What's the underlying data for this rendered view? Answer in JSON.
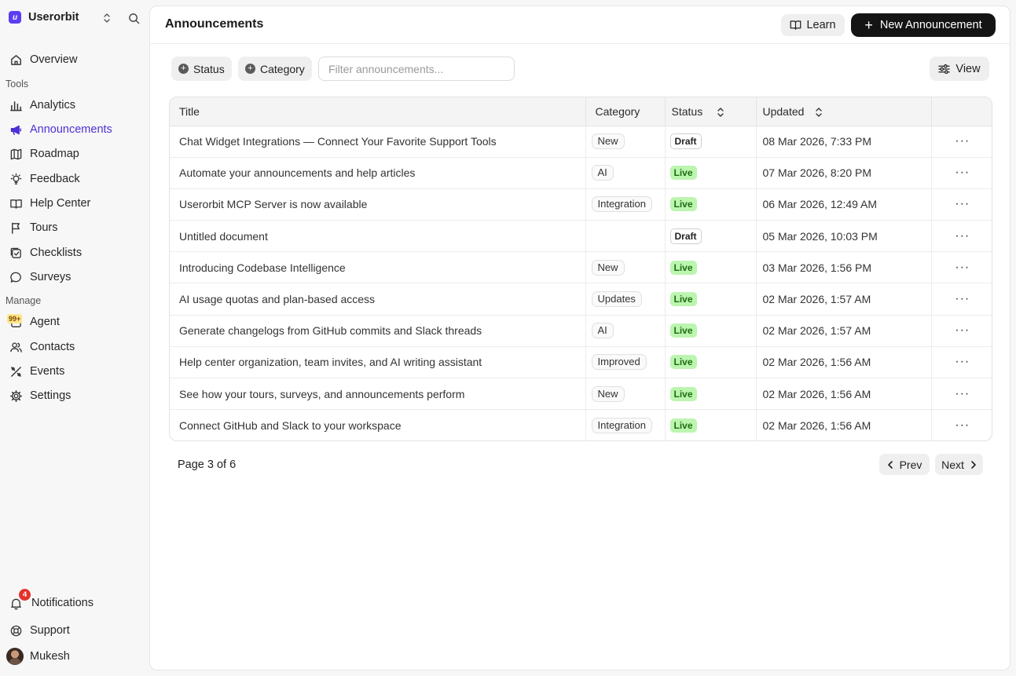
{
  "workspace": {
    "logo_letter": "u",
    "name": "Userorbit"
  },
  "sidebar": {
    "overview": "Overview",
    "tools_label": "Tools",
    "tools": [
      {
        "label": "Analytics",
        "icon": "bar-chart-icon"
      },
      {
        "label": "Announcements",
        "icon": "megaphone-icon",
        "active": true
      },
      {
        "label": "Roadmap",
        "icon": "map-icon"
      },
      {
        "label": "Feedback",
        "icon": "lightbulb-icon"
      },
      {
        "label": "Help Center",
        "icon": "book-icon"
      },
      {
        "label": "Tours",
        "icon": "flag-icon"
      },
      {
        "label": "Checklists",
        "icon": "checklist-icon"
      },
      {
        "label": "Surveys",
        "icon": "chat-bubble-icon"
      }
    ],
    "manage_label": "Manage",
    "manage": [
      {
        "label": "Agent",
        "icon": "agent-icon",
        "badge": "99+"
      },
      {
        "label": "Contacts",
        "icon": "users-icon"
      },
      {
        "label": "Events",
        "icon": "events-icon"
      },
      {
        "label": "Settings",
        "icon": "gear-icon"
      }
    ],
    "notifications": {
      "label": "Notifications",
      "badge": "4"
    },
    "support": "Support",
    "user": "Mukesh"
  },
  "header": {
    "title": "Announcements",
    "learn_label": "Learn",
    "new_label": "New Announcement"
  },
  "filters": {
    "status_label": "Status",
    "category_label": "Category",
    "search_placeholder": "Filter announcements...",
    "view_label": "View"
  },
  "table": {
    "columns": [
      "Title",
      "Category",
      "Status",
      "Updated",
      ""
    ],
    "rows": [
      {
        "title": "Chat Widget Integrations — Connect Your Favorite Support Tools",
        "category": "New",
        "status": "Draft",
        "updated": "08 Mar 2026, 7:33 PM"
      },
      {
        "title": "Automate your announcements and help articles",
        "category": "AI",
        "status": "Live",
        "updated": "07 Mar 2026, 8:20 PM"
      },
      {
        "title": "Userorbit MCP Server is now available",
        "category": "Integration",
        "status": "Live",
        "updated": "06 Mar 2026, 12:49 AM"
      },
      {
        "title": "Untitled document",
        "category": "",
        "status": "Draft",
        "updated": "05 Mar 2026, 10:03 PM"
      },
      {
        "title": "Introducing Codebase Intelligence",
        "category": "New",
        "status": "Live",
        "updated": "03 Mar 2026, 1:56 PM"
      },
      {
        "title": "AI usage quotas and plan-based access",
        "category": "Updates",
        "status": "Live",
        "updated": "02 Mar 2026, 1:57 AM"
      },
      {
        "title": "Generate changelogs from GitHub commits and Slack threads",
        "category": "AI",
        "status": "Live",
        "updated": "02 Mar 2026, 1:57 AM"
      },
      {
        "title": "Help center organization, team invites, and AI writing assistant",
        "category": "Improved",
        "status": "Live",
        "updated": "02 Mar 2026, 1:56 AM"
      },
      {
        "title": "See how your tours, surveys, and announcements perform",
        "category": "New",
        "status": "Live",
        "updated": "02 Mar 2026, 1:56 AM"
      },
      {
        "title": "Connect GitHub and Slack to your workspace",
        "category": "Integration",
        "status": "Live",
        "updated": "02 Mar 2026, 1:56 AM"
      }
    ],
    "row_action": "···"
  },
  "pagination": {
    "info": "Page 3 of 6",
    "prev_label": "Prev",
    "next_label": "Next"
  },
  "colors": {
    "accent": "#4f2fd6",
    "live_bg": "#bcf5b0",
    "live_text": "#1d6e10",
    "primary_button": "#141414",
    "notification_badge": "#e5322d"
  }
}
